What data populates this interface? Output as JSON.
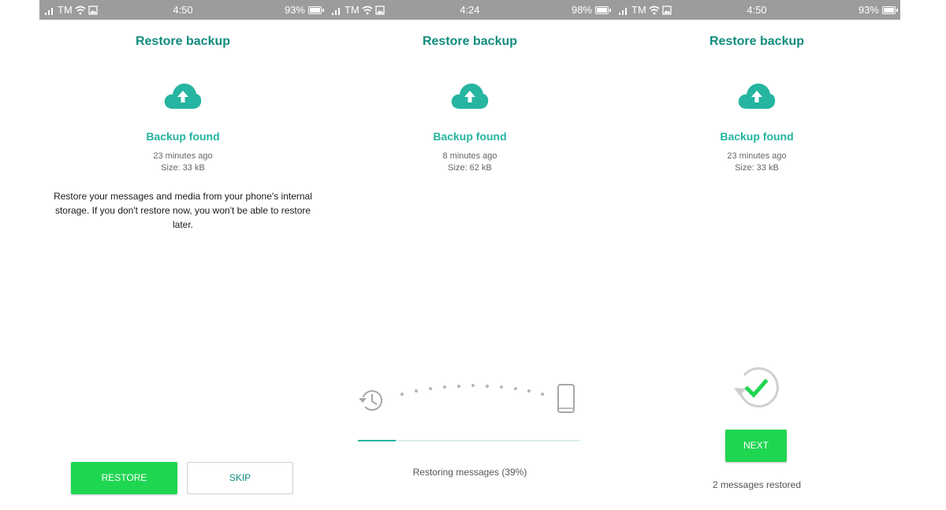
{
  "colors": {
    "title": "#128c7e",
    "accent_green": "#1fd651",
    "teal": "#25b5a0",
    "status_bar": "#9c9c9c"
  },
  "screens": [
    {
      "status": {
        "carrier": "TM",
        "time": "4:50",
        "battery": "93%"
      },
      "title": "Restore backup",
      "icon": "cloud-upload-icon",
      "found": "Backup found",
      "age": "23 minutes ago",
      "size": "Size: 33 kB",
      "description": "Restore your messages and media from your phone's internal storage. If you don't restore now, you won't be able to restore later.",
      "restore_label": "RESTORE",
      "skip_label": "SKIP"
    },
    {
      "status": {
        "carrier": "TM",
        "time": "4:24",
        "battery": "98%"
      },
      "title": "Restore backup",
      "icon": "cloud-upload-icon",
      "found": "Backup found",
      "age": "8 minutes ago",
      "size": "Size: 62 kB",
      "progress_fraction": 0.17,
      "progress_label": "Restoring messages (39%)"
    },
    {
      "status": {
        "carrier": "TM",
        "time": "4:50",
        "battery": "93%"
      },
      "title": "Restore backup",
      "icon": "cloud-upload-icon",
      "found": "Backup found",
      "age": "23 minutes ago",
      "size": "Size: 33 kB",
      "next_label": "NEXT",
      "restored_label": "2 messages restored"
    }
  ]
}
